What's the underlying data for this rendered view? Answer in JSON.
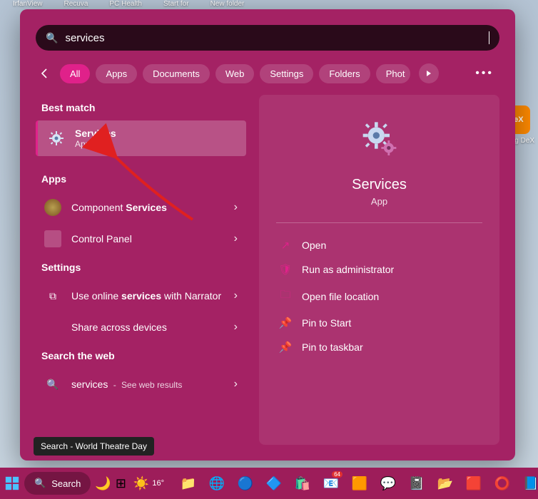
{
  "desktop_shortcuts": [
    "IrfanView",
    "Recuva",
    "PC Health",
    "Start for",
    "New folder"
  ],
  "side_icon": {
    "label": "DeX",
    "caption": "msung\nDeX"
  },
  "search": {
    "query": "services"
  },
  "tabs": {
    "items": [
      "All",
      "Apps",
      "Documents",
      "Web",
      "Settings",
      "Folders",
      "Phot"
    ],
    "active_index": 0
  },
  "sections": {
    "best_match": {
      "header": "Best match",
      "title": "Services",
      "subtitle": "App"
    },
    "apps": {
      "header": "Apps",
      "items": [
        {
          "pre": "Component ",
          "bold": "Services"
        },
        {
          "pre": "Control Panel",
          "bold": ""
        }
      ]
    },
    "settings": {
      "header": "Settings",
      "items": [
        {
          "pre": "Use online ",
          "bold": "services",
          "post": " with Narrator"
        },
        {
          "pre": "Share across devices",
          "bold": "",
          "post": ""
        }
      ]
    },
    "web": {
      "header": "Search the web",
      "query": "services",
      "suffix": "See web results"
    }
  },
  "detail": {
    "title": "Services",
    "subtitle": "App",
    "actions": [
      "Open",
      "Run as administrator",
      "Open file location",
      "Pin to Start",
      "Pin to taskbar"
    ]
  },
  "tooltip": "Search - World Theatre Day",
  "taskbar": {
    "search": "Search",
    "weather": "16°"
  }
}
